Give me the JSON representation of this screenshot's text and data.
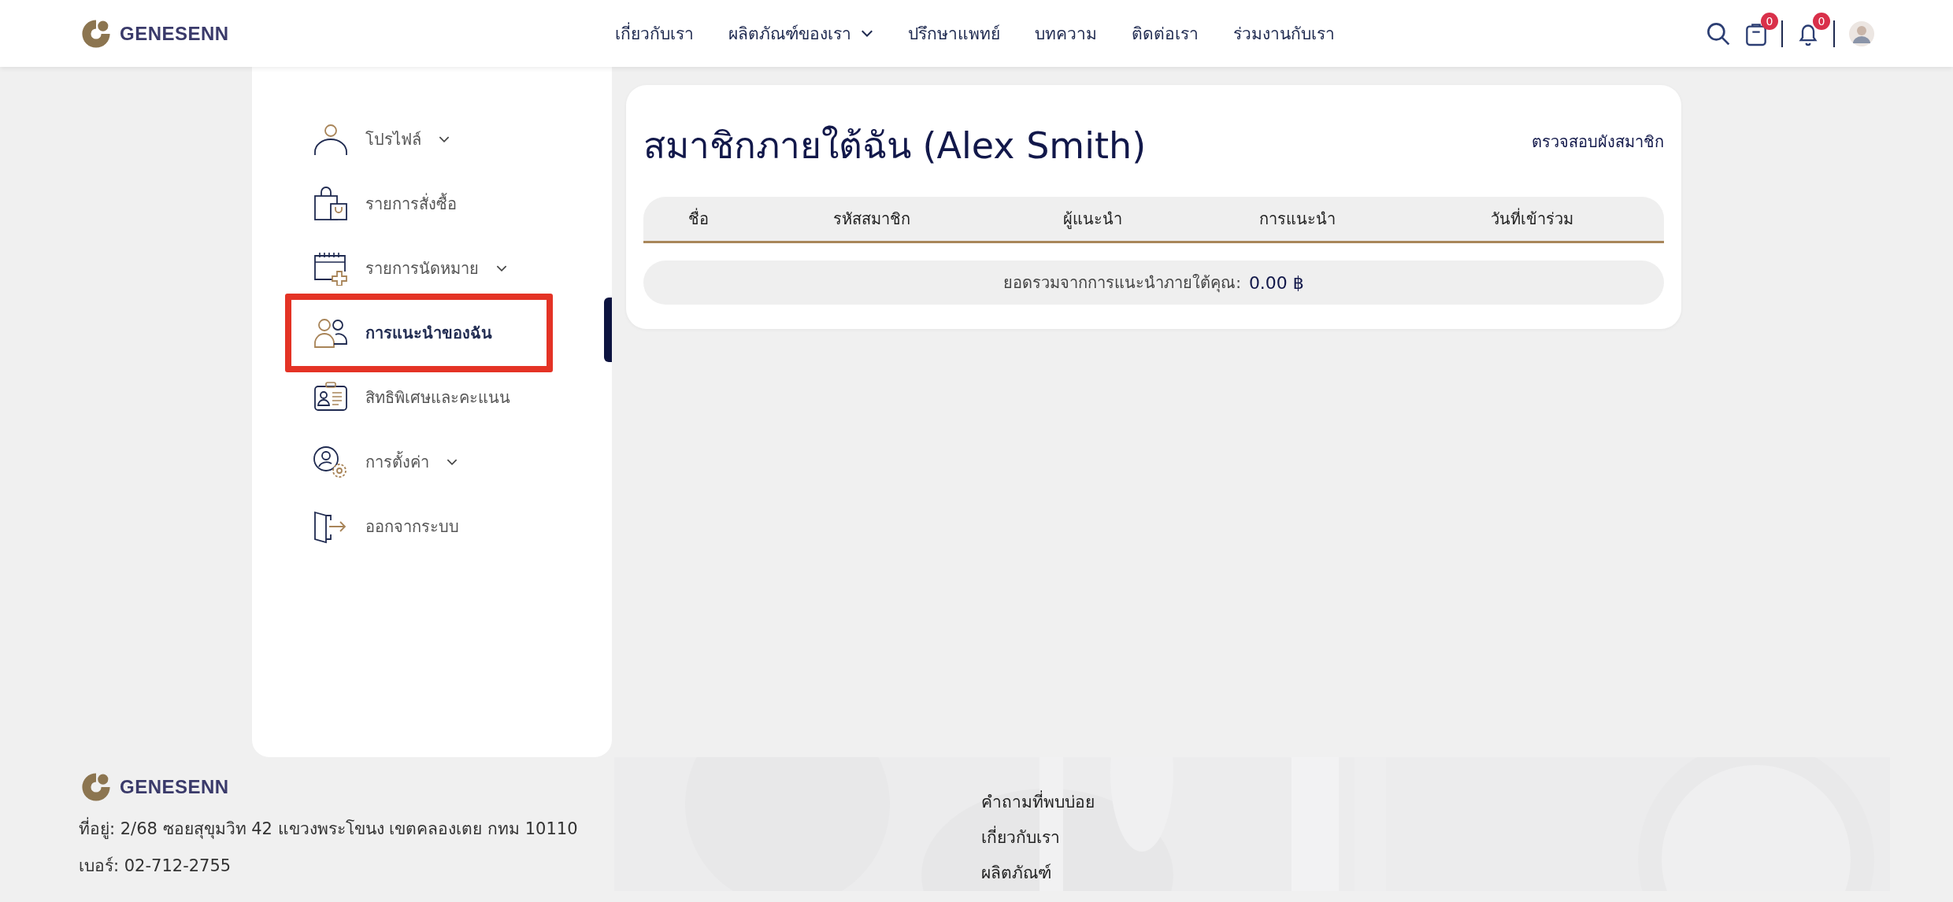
{
  "header": {
    "logo": "GENESENN",
    "nav": [
      {
        "label": "เกี่ยวกับเรา",
        "dropdown": false
      },
      {
        "label": "ผลิตภัณฑ์ของเรา",
        "dropdown": true
      },
      {
        "label": "ปรึกษาแพทย์",
        "dropdown": false
      },
      {
        "label": "บทความ",
        "dropdown": false
      },
      {
        "label": "ติดต่อเรา",
        "dropdown": false
      },
      {
        "label": "ร่วมงานกับเรา",
        "dropdown": false
      }
    ],
    "cart_badge": "0",
    "notification_badge": "0"
  },
  "sidebar": {
    "items": [
      {
        "label": "โปรไฟล์",
        "kind": "profile",
        "dropdown": true,
        "selected": false,
        "highlighted": false
      },
      {
        "label": "รายการสั่งซื้อ",
        "kind": "orders",
        "dropdown": false,
        "selected": false,
        "highlighted": false
      },
      {
        "label": "รายการนัดหมาย",
        "kind": "appointments",
        "dropdown": true,
        "selected": false,
        "highlighted": false
      },
      {
        "label": "การแนะนำของฉัน",
        "kind": "referrals",
        "dropdown": false,
        "selected": true,
        "highlighted": true
      },
      {
        "label": "สิทธิพิเศษและคะแนน",
        "kind": "privileges",
        "dropdown": false,
        "selected": false,
        "highlighted": false
      },
      {
        "label": "การตั้งค่า",
        "kind": "settings",
        "dropdown": true,
        "selected": false,
        "highlighted": false
      },
      {
        "label": "ออกจากระบบ",
        "kind": "logout",
        "dropdown": false,
        "selected": false,
        "highlighted": false
      }
    ]
  },
  "main": {
    "title": "สมาชิกภายใต้ฉัน (Alex Smith)",
    "link": "ตรวจสอบผังสมาชิก",
    "table": {
      "columns": [
        "ชื่อ",
        "รหัสสมาชิก",
        "ผู้แนะนำ",
        "การแนะนำ",
        "วันที่เข้าร่วม"
      ]
    },
    "total_label": "ยอดรวมจากการแนะนำภายใต้คุณ:",
    "total_value": "0.00 ฿"
  },
  "footer": {
    "logo": "GENESENN",
    "address": "ที่อยู่: 2/68 ซอยสุขุมวิท 42 แขวงพระโขนง เขตคลองเตย กทม 10110",
    "phone": "เบอร์: 02-712-2755",
    "links": [
      "คำถามที่พบบ่อย",
      "เกี่ยวกับเรา",
      "ผลิตภัณฑ์"
    ]
  }
}
